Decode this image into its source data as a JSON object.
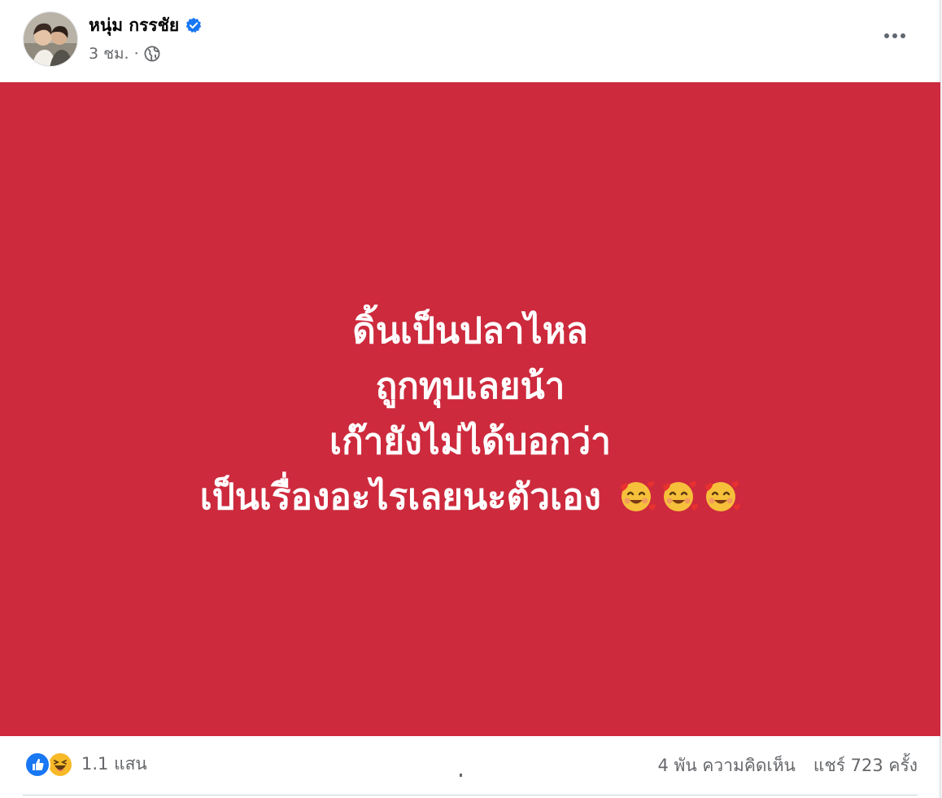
{
  "post": {
    "author": {
      "name": "หนุ่ม กรรชัย",
      "verified": true,
      "avatar_icon": "profile-photo"
    },
    "meta": {
      "time": "3 ชม.",
      "separator": "·",
      "audience_icon": "globe-icon"
    },
    "more_icon": "more-options-icon",
    "background_color": "#cd2a3d",
    "text_lines": [
      "ดิ้นเป็นปลาไหล",
      "ถูกทุบเลยน้า",
      "เก๊ายังไม่ได้บอกว่า",
      "เป็นเรื่องอะไรเลยนะตัวเอง"
    ],
    "emoji_icons": [
      "smiling-face-with-hearts-emoji",
      "smiling-face-with-hearts-emoji",
      "smiling-face-with-hearts-emoji"
    ]
  },
  "footer": {
    "reaction_icons": [
      "like-reaction-icon",
      "haha-reaction-icon"
    ],
    "reaction_count": "1.1 แสน",
    "comments": "4 พัน ความคิดเห็น",
    "shares": "แชร์ 723 ครั้ง"
  },
  "colors": {
    "accent": "#1877f2",
    "text_secondary": "#65676b",
    "post_background": "#cd2a3d"
  }
}
